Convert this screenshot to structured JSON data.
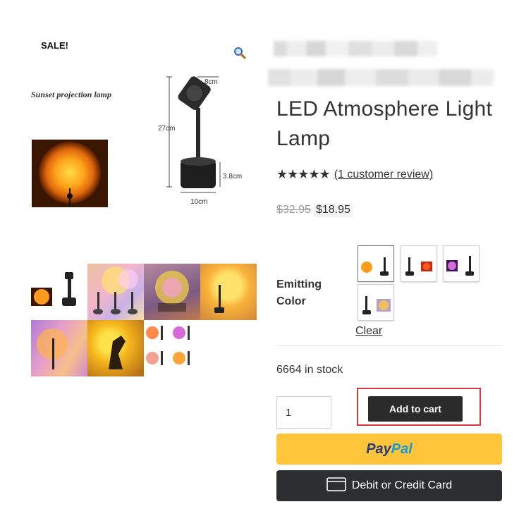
{
  "badges": {
    "sale": "SALE!"
  },
  "icons": {
    "zoom": "magnifier-icon",
    "card": "credit-card-icon",
    "star": "star-icon"
  },
  "product": {
    "image_caption": "Sunset projection lamp",
    "dim_width": "8cm",
    "dim_height": "27cm",
    "dim_base_h": "3.8cm",
    "dim_base_w": "10cm",
    "title": "LED Atmosphere Light Lamp",
    "rating": 5,
    "stars_text": "★★★★★",
    "review_link": "(1 customer review)",
    "price_old": "$32.95",
    "price_new": "$18.95",
    "stock": "6664 in stock"
  },
  "variations": {
    "label": "Emitting Color",
    "clear": "Clear",
    "selected_index": 0
  },
  "cart": {
    "quantity": "1",
    "add_label": "Add to cart"
  },
  "payments": {
    "paypal_part1": "Pay",
    "paypal_part2": "Pal",
    "card_label": "Debit or Credit Card"
  },
  "colors": {
    "accent_border": "#d9363e",
    "paypal": "#ffc439",
    "dark_btn": "#2b2b2b"
  }
}
